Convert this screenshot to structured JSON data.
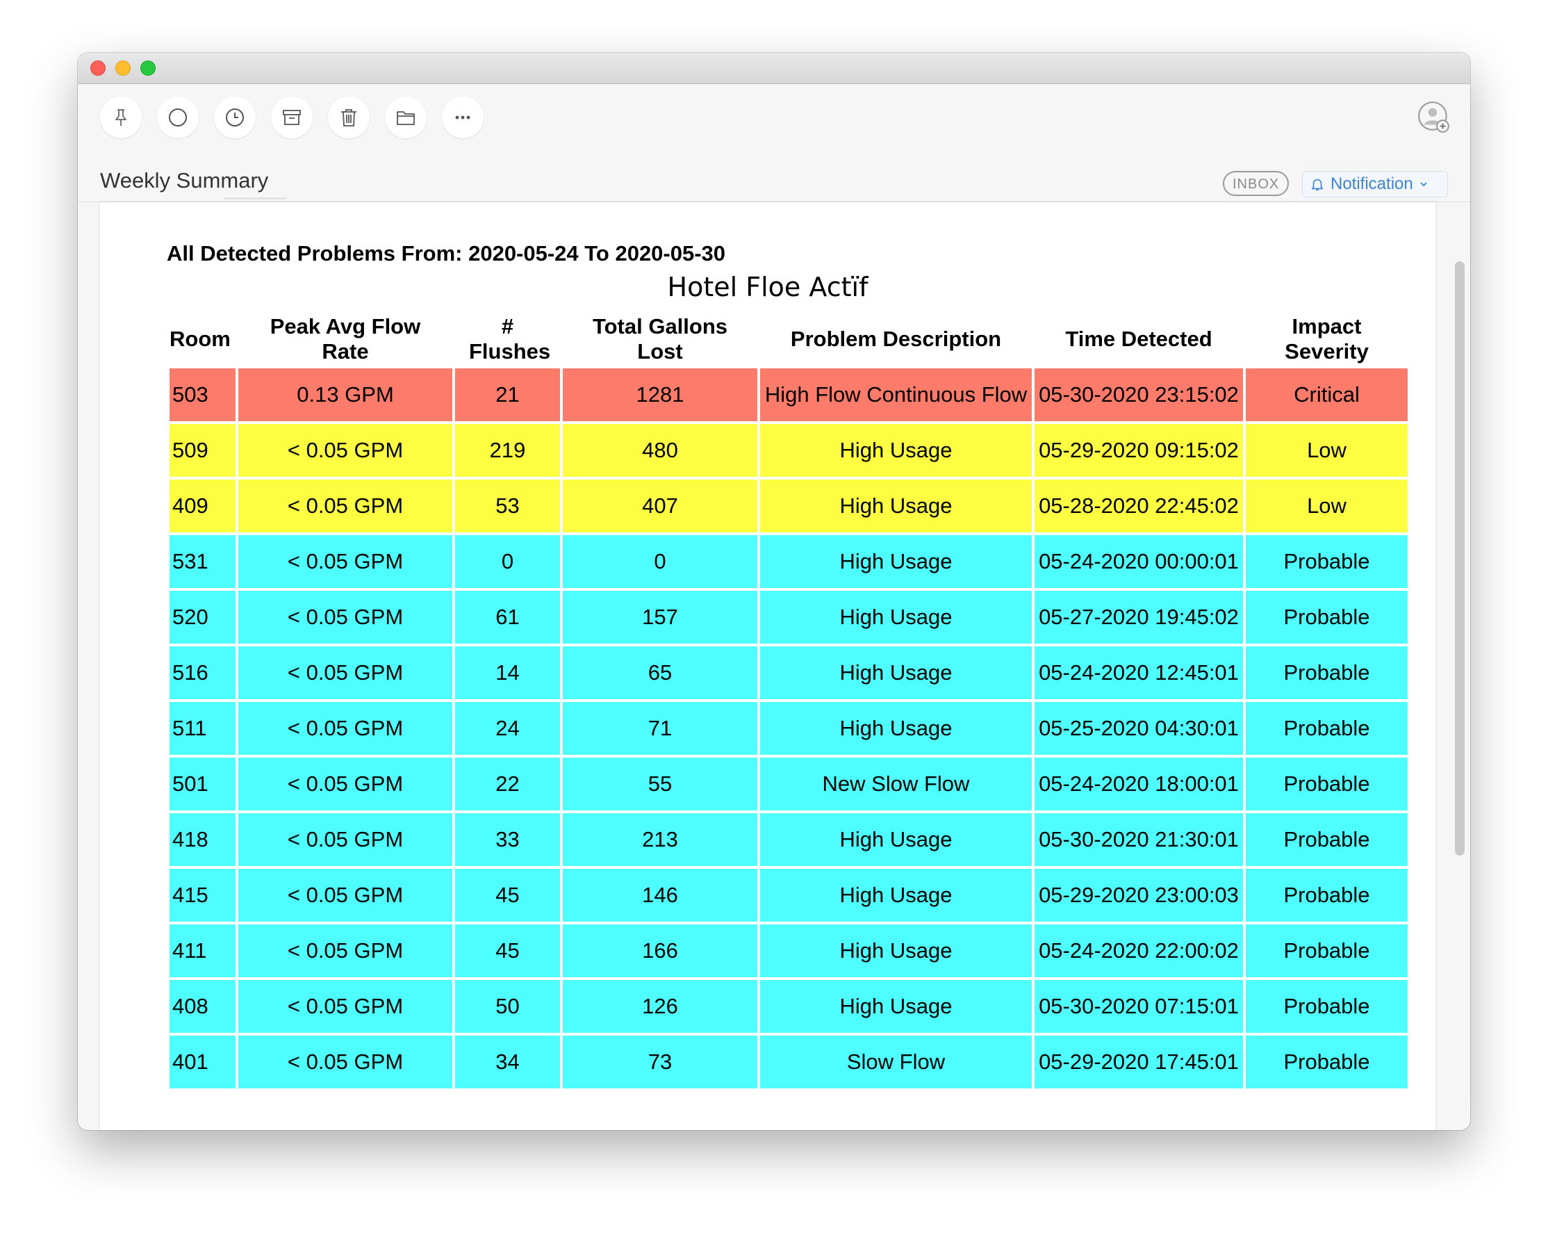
{
  "window": {
    "subject": "Weekly Summary",
    "inbox_badge": "INBOX",
    "notification_label": "Notification"
  },
  "toolbar": {
    "icons": [
      "pin-icon",
      "circle-icon",
      "clock-icon",
      "archive-icon",
      "trash-icon",
      "folder-icon",
      "more-icon"
    ],
    "profile_icon": "add-contact-icon"
  },
  "email": {
    "heading": "All Detected Problems From: 2020-05-24 To 2020-05-30",
    "hotel_name": "Hotel Floe Actïf",
    "columns": [
      "Room",
      "Peak Avg Flow Rate",
      "# Flushes",
      "Total Gallons Lost",
      "Problem Description",
      "Time Detected",
      "Impact Severity"
    ],
    "severity_colors": {
      "Critical": "#fd7b6a",
      "Low": "#fdfd41",
      "Probable": "#4efdfd"
    },
    "rows": [
      [
        "503",
        "0.13 GPM",
        "21",
        "1281",
        "High Flow Continuous Flow",
        "05-30-2020 23:15:02",
        "Critical"
      ],
      [
        "509",
        "< 0.05 GPM",
        "219",
        "480",
        "High Usage",
        "05-29-2020 09:15:02",
        "Low"
      ],
      [
        "409",
        "< 0.05 GPM",
        "53",
        "407",
        "High Usage",
        "05-28-2020 22:45:02",
        "Low"
      ],
      [
        "531",
        "< 0.05 GPM",
        "0",
        "0",
        "High Usage",
        "05-24-2020 00:00:01",
        "Probable"
      ],
      [
        "520",
        "< 0.05 GPM",
        "61",
        "157",
        "High Usage",
        "05-27-2020 19:45:02",
        "Probable"
      ],
      [
        "516",
        "< 0.05 GPM",
        "14",
        "65",
        "High Usage",
        "05-24-2020 12:45:01",
        "Probable"
      ],
      [
        "511",
        "< 0.05 GPM",
        "24",
        "71",
        "High Usage",
        "05-25-2020 04:30:01",
        "Probable"
      ],
      [
        "501",
        "< 0.05 GPM",
        "22",
        "55",
        "New Slow Flow",
        "05-24-2020 18:00:01",
        "Probable"
      ],
      [
        "418",
        "< 0.05 GPM",
        "33",
        "213",
        "High Usage",
        "05-30-2020 21:30:01",
        "Probable"
      ],
      [
        "415",
        "< 0.05 GPM",
        "45",
        "146",
        "High Usage",
        "05-29-2020 23:00:03",
        "Probable"
      ],
      [
        "411",
        "< 0.05 GPM",
        "45",
        "166",
        "High Usage",
        "05-24-2020 22:00:02",
        "Probable"
      ],
      [
        "408",
        "< 0.05 GPM",
        "50",
        "126",
        "High Usage",
        "05-30-2020 07:15:01",
        "Probable"
      ],
      [
        "401",
        "< 0.05 GPM",
        "34",
        "73",
        "Slow Flow",
        "05-29-2020 17:45:01",
        "Probable"
      ]
    ]
  }
}
